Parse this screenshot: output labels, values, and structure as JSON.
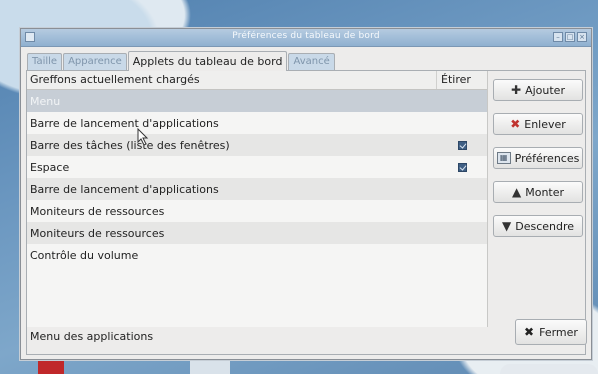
{
  "window": {
    "title": "Préférences du tableau de bord",
    "minimize_glyph": "–",
    "maximize_glyph": "□",
    "close_glyph": "×"
  },
  "tabs": [
    {
      "label": "Taille"
    },
    {
      "label": "Apparence"
    },
    {
      "label": "Applets du tableau de bord"
    },
    {
      "label": "Avancé"
    }
  ],
  "list": {
    "header_name": "Greffons actuellement chargés",
    "header_stretch": "Étirer",
    "rows": [
      {
        "name": "Menu",
        "stretch": false,
        "selected": true
      },
      {
        "name": "Barre de lancement d'applications",
        "stretch": false
      },
      {
        "name": "Barre des tâches (liste des fenêtres)",
        "stretch": true
      },
      {
        "name": "Espace",
        "stretch": true
      },
      {
        "name": "Barre de lancement d'applications",
        "stretch": false
      },
      {
        "name": "Moniteurs de ressources",
        "stretch": false
      },
      {
        "name": "Moniteurs de ressources",
        "stretch": false
      },
      {
        "name": "Contrôle du volume",
        "stretch": false
      }
    ]
  },
  "status_text": "Menu des applications",
  "buttons": {
    "add": "Ajouter",
    "remove": "Enlever",
    "preferences": "Préférences",
    "move_up": "Monter",
    "move_down": "Descendre",
    "close": "Fermer"
  },
  "icons": {
    "add": "plus-icon",
    "remove": "x-icon",
    "preferences": "preferences-icon",
    "move_up": "arrow-up-icon",
    "move_down": "arrow-down-icon",
    "close": "x-icon"
  },
  "colors": {
    "remove_icon": "#c0332f",
    "titlebar": "#8fb0d0",
    "selected_row": "#c7ced6"
  }
}
